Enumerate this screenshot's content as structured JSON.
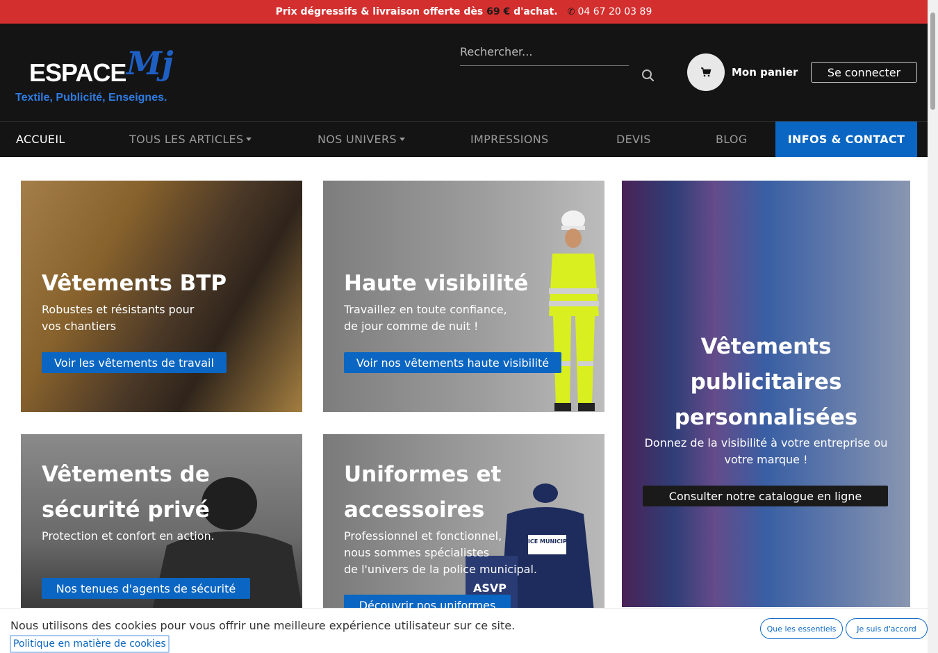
{
  "topbar": {
    "promo_prefix": "Prix dégressifs & livraison offerte dès",
    "promo_price": "69 €",
    "promo_suffix": "d'achat.",
    "phone": "04 67 20 03 89"
  },
  "header": {
    "logo_brand": "ESPACE",
    "logo_mark": "Mj",
    "logo_tagline": "Textile, Publicité, Enseignes.",
    "search_placeholder": "Rechercher...",
    "cart_label": "Mon panier",
    "login_label": "Se connecter"
  },
  "nav": {
    "items": [
      {
        "label": "ACCUEIL"
      },
      {
        "label": "TOUS LES ARTICLES"
      },
      {
        "label": "NOS UNIVERS"
      },
      {
        "label": "IMPRESSIONS"
      },
      {
        "label": "DEVIS"
      },
      {
        "label": "BLOG"
      },
      {
        "label": "INFOS & CONTACT"
      }
    ]
  },
  "cards": [
    {
      "title": "Vêtements BTP",
      "text_line1": "Robustes et résistants pour",
      "text_line2": "vos chantiers",
      "cta": "Voir les vêtements de travail"
    },
    {
      "title": "Haute visibilité",
      "text_line1": "Travaillez en toute confiance,",
      "text_line2": "de jour comme de nuit !",
      "cta": "Voir nos vêtements haute visibilité"
    },
    {
      "title_line1": "Vêtements",
      "title_line2": "publicitaires",
      "title_line3": "personnalisées",
      "text_line1": "Donnez de la visibilité à votre entreprise ou",
      "text_line2": "votre marque !",
      "cta": "Consulter notre catalogue en ligne"
    },
    {
      "title_line1": "Vêtements de",
      "title_line2": "sécurité privé",
      "text_line1": "Protection et confort en action.",
      "cta": "Nos tenues d'agents de sécurité"
    },
    {
      "title_line1": "Uniformes et",
      "title_line2": "accessoires",
      "text_line1": "Professionnel et fonctionnel,",
      "text_line2": "nous sommes spécialistes",
      "text_line3": "de l'univers de la police municipal.",
      "cta": "Découvrir nos uniformes",
      "badge_back": "POLICE MUNICIPALE",
      "badge_asvp": "ASVP"
    }
  ],
  "cookie": {
    "text": "Nous utilisons des cookies pour vous offrir une meilleure expérience utilisateur sur ce site.",
    "policy_link": "Politique en matière de cookies",
    "essential_button": "Que les essentiels",
    "accept_button": "Je suis d'accord"
  },
  "colors": {
    "topbar": "#d32f2f",
    "header_bg": "#141414",
    "accent": "#0a66c2"
  }
}
